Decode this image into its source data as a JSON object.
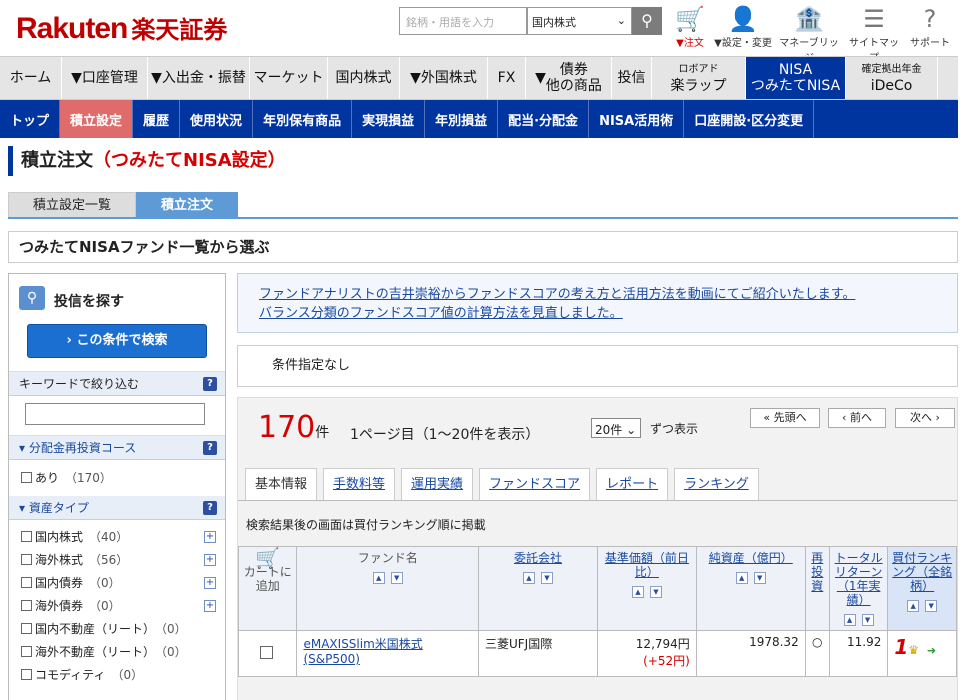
{
  "header": {
    "logo_en": "Rakuten",
    "logo_jp": "楽天証券",
    "search_placeholder": "銘柄・用語を入力",
    "search_scope": "国内株式",
    "icons": [
      {
        "name": "cart-icon",
        "label": "▼注文"
      },
      {
        "name": "user-icon",
        "label": "▼設定・変更"
      },
      {
        "name": "bank-icon",
        "label": "マネーブリッジ"
      },
      {
        "name": "sitemap-icon",
        "label": "サイトマップ"
      },
      {
        "name": "support-icon",
        "label": "サポート"
      }
    ]
  },
  "mainnav": [
    {
      "label": "ホーム"
    },
    {
      "label": "▼口座管理"
    },
    {
      "label": "▼入出金・振替"
    },
    {
      "label": "マーケット"
    },
    {
      "label": "国内株式"
    },
    {
      "label": "▼外国株式"
    },
    {
      "label": "FX"
    },
    {
      "label": "▼",
      "line1": "債券",
      "line2": "他の商品"
    },
    {
      "label": "投信"
    },
    {
      "small": "ロボアド",
      "label": "楽ラップ"
    },
    {
      "line1": "NISA",
      "line2": "つみたてNISA"
    },
    {
      "small": "確定拠出年金",
      "label": "iDeCo"
    }
  ],
  "subnav": [
    "トップ",
    "積立設定",
    "履歴",
    "使用状況",
    "年別保有商品",
    "実現損益",
    "年別損益",
    "配当·分配金",
    "NISA活用術",
    "口座開設·区分変更"
  ],
  "page_title": "積立注文",
  "page_title_sub": "（つみたてNISA設定）",
  "tabs": [
    "積立設定一覧",
    "積立注文"
  ],
  "section_heading": "つみたてNISAファンド一覧から選ぶ",
  "sidebar": {
    "title": "投信を探す",
    "search_button": "この条件で検索",
    "keyword_label": "キーワードで絞り込む",
    "reinvest_label": "分配金再投資コース",
    "reinvest_items": [
      {
        "label": "あり",
        "count": "（170）"
      }
    ],
    "asset_label": "資産タイプ",
    "asset_items": [
      {
        "label": "国内株式",
        "count": "（40）"
      },
      {
        "label": "海外株式",
        "count": "（56）"
      },
      {
        "label": "国内債券",
        "count": "（0）"
      },
      {
        "label": "海外債券",
        "count": "（0）"
      },
      {
        "label": "国内不動産（リート）",
        "count": "（0）"
      },
      {
        "label": "海外不動産（リート）",
        "count": "（0）"
      },
      {
        "label": "コモディティ",
        "count": "（0）"
      }
    ]
  },
  "notice": [
    "ファンドアナリストの吉井崇裕からファンドスコアの考え方と活用方法を動画にてご紹介いたします。",
    "バランス分類のファンドスコア値の計算方法を見直しました。"
  ],
  "condition": "条件指定なし",
  "results": {
    "count": "170",
    "count_unit": "件",
    "page_info": "1ページ目（1〜20件を表示）",
    "per_page": "20件",
    "per_page_suffix": "ずつ表示",
    "first": "« 先頭へ",
    "prev": "‹ 前へ",
    "next": "次へ ›",
    "tabs": [
      "基本情報",
      "手数料等",
      "運用実績",
      "ファンドスコア",
      "レポート",
      "ランキング"
    ],
    "note": "検索結果後の画面は買付ランキング順に掲載",
    "columns": {
      "cart": "カートに追加",
      "name": "ファンド名",
      "company": "委託会社",
      "nav": "基準価額（前日比）",
      "assets": "純資産（億円）",
      "reinvest": "再投資",
      "return": "トータルリターン（1年実績）",
      "rank": "買付ランキング（全銘柄）"
    },
    "rows": [
      {
        "name": "eMAXISSlim米国株式(S&P500)",
        "company": "三菱UFJ国際",
        "nav": "12,794円",
        "change": "(+52円)",
        "assets": "1978.32",
        "reinvest": "○",
        "return": "11.92",
        "rank": "1"
      }
    ]
  },
  "colors": {
    "brand": "#bf0000",
    "nav_active": "#00349e",
    "subnav_active": "#e06b6b"
  }
}
